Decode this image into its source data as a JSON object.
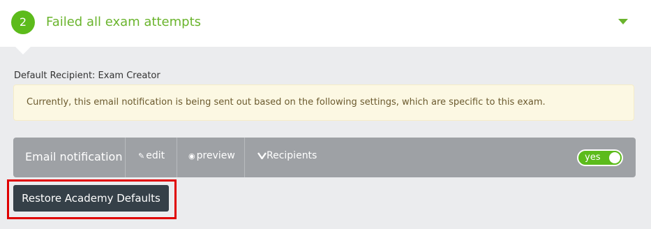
{
  "step": {
    "number": "2",
    "title": "Failed all exam attempts",
    "accent_color": "#5cbb1b",
    "collapse_icon": "chevron-down-icon"
  },
  "default_recipient": "Default Recipient: Exam Creator",
  "notice": {
    "text": "Currently, this email notification is being sent out based on the following settings, which are specific to this exam."
  },
  "toolbar": {
    "label": "Email notification",
    "edit_label": "edit",
    "edit_icon": "pencil-icon",
    "preview_label": "preview",
    "preview_icon": "eye-icon",
    "recipients_label": "Recipients",
    "recipients_icon": "chevron-down-icon",
    "toggle_label": "yes",
    "toggle_on": true
  },
  "restore_button": {
    "label": "Restore Academy Defaults",
    "highlight_color": "#e00000"
  }
}
